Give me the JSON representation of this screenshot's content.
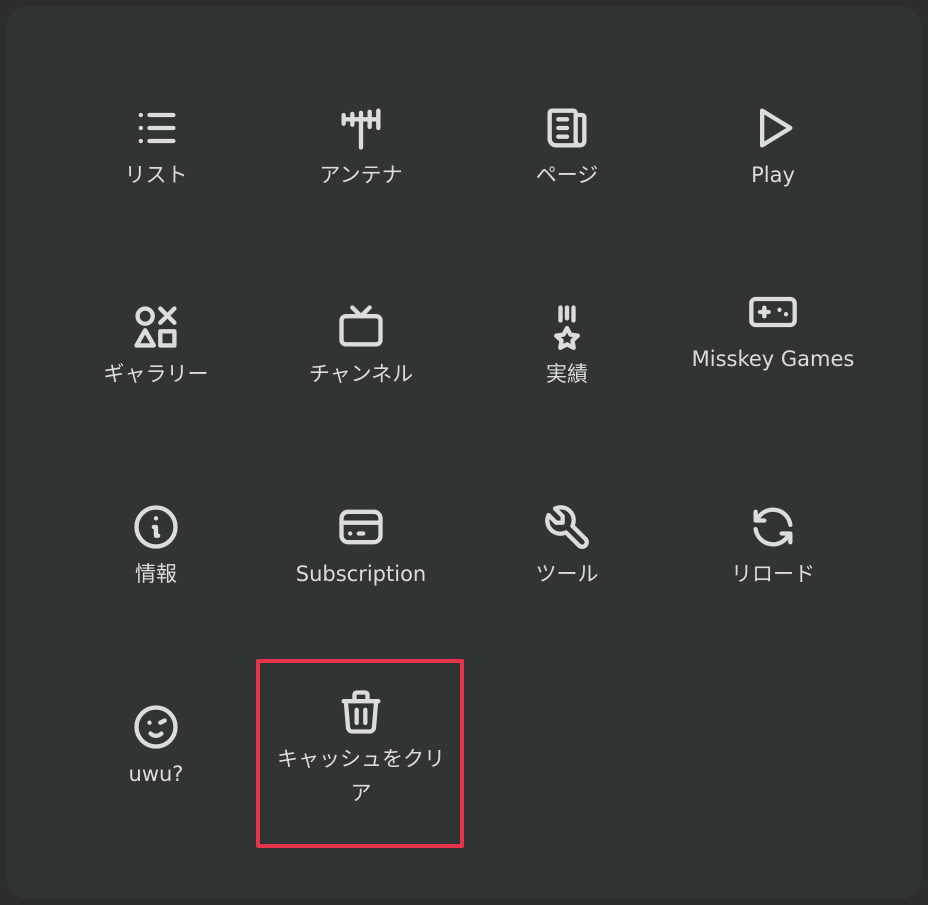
{
  "menu": {
    "items": [
      {
        "id": "list",
        "label": "リスト",
        "icon": "list-icon"
      },
      {
        "id": "antenna",
        "label": "アンテナ",
        "icon": "antenna-icon"
      },
      {
        "id": "pages",
        "label": "ページ",
        "icon": "news-icon"
      },
      {
        "id": "play",
        "label": "Play",
        "icon": "play-icon"
      },
      {
        "id": "gallery",
        "label": "ギャラリー",
        "icon": "shapes-icon"
      },
      {
        "id": "channel",
        "label": "チャンネル",
        "icon": "tv-icon"
      },
      {
        "id": "achievements",
        "label": "実績",
        "icon": "medal-icon"
      },
      {
        "id": "games",
        "label": "Misskey Games",
        "icon": "gamepad-icon"
      },
      {
        "id": "about",
        "label": "情報",
        "icon": "info-circle-icon"
      },
      {
        "id": "subscription",
        "label": "Subscription",
        "icon": "credit-card-icon"
      },
      {
        "id": "tools",
        "label": "ツール",
        "icon": "wrench-icon"
      },
      {
        "id": "reload",
        "label": "リロード",
        "icon": "refresh-icon"
      },
      {
        "id": "uwu",
        "label": "uwu?",
        "icon": "mood-wink-icon"
      },
      {
        "id": "clear-cache",
        "label": "キャッシュをクリア",
        "icon": "trash-icon"
      }
    ]
  },
  "colors": {
    "panel": "#303435",
    "foreground": "#dcdcdc",
    "highlight": "#e8344a"
  }
}
